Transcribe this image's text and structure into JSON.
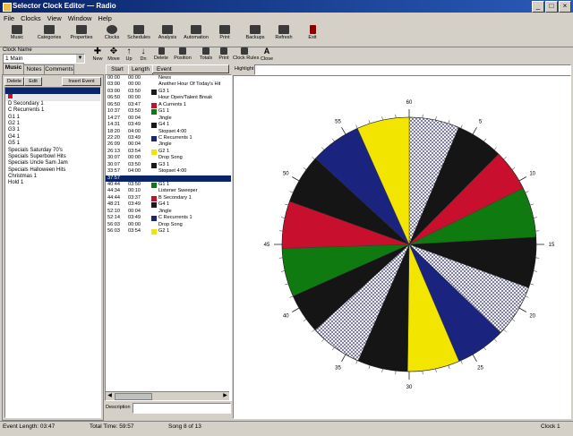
{
  "window": {
    "title": "Selector Clock Editor — Radio"
  },
  "menu": [
    "File",
    "Clocks",
    "View",
    "Window",
    "Help"
  ],
  "toolbar_top": [
    "Music",
    "Categories",
    "Properties",
    "Clocks",
    "Schedules",
    "Analysis",
    "Automation",
    "Print",
    "Backups",
    "Refresh",
    "Exit"
  ],
  "toolbar_nav": [
    "New",
    "Move",
    "Up",
    "Dn",
    "Delete",
    "Position",
    "Totals",
    "Print",
    "Clock Rules",
    "Close"
  ],
  "clock_name": {
    "label": "Clock Name",
    "value": "1 Main"
  },
  "left_tabs": [
    "Music",
    "Notes",
    "Comments"
  ],
  "left_buttons": [
    "Delete",
    "Edit",
    "Insert Event"
  ],
  "left_items": [
    "",
    "",
    "D Secondary 1",
    "C Recurrents 1",
    "G1 1",
    "G2 1",
    "G3 1",
    "G4 1",
    "G5 1",
    "Specials Saturday 70's",
    "Specials Superbowl Hits",
    "Specials Uncle Sam Jam",
    "Specials Halloween Hits",
    "Christmas 1",
    "Hold 1"
  ],
  "columns": [
    "Start",
    "Length",
    "Event"
  ],
  "events": [
    {
      "start": "00:00",
      "len": "00:00",
      "color": "",
      "name": "News"
    },
    {
      "start": "03:00",
      "len": "00:00",
      "color": "",
      "name": "Another Hour Of Today's Hit"
    },
    {
      "start": "03:00",
      "len": "03:50",
      "color": "#1a1a1a",
      "name": "G3 1"
    },
    {
      "start": "06:50",
      "len": "00:00",
      "color": "",
      "name": "Hour Open/Talent Break"
    },
    {
      "start": "06:50",
      "len": "03:47",
      "color": "#c8102e",
      "name": "A Currents 1"
    },
    {
      "start": "10:37",
      "len": "03:50",
      "color": "#0f7a0f",
      "name": "G1 1"
    },
    {
      "start": "14:27",
      "len": "00:04",
      "color": "",
      "name": "Jingle"
    },
    {
      "start": "14:31",
      "len": "03:49",
      "color": "#1a1a1a",
      "name": "G4 1"
    },
    {
      "start": "18:20",
      "len": "04:00",
      "color": "",
      "name": "Stopset 4:00"
    },
    {
      "start": "22:20",
      "len": "03:49",
      "color": "#1a237e",
      "name": "C Recurrents 1"
    },
    {
      "start": "26:09",
      "len": "00:04",
      "color": "",
      "name": "Jingle"
    },
    {
      "start": "26:13",
      "len": "03:54",
      "color": "#f2e600",
      "name": "G2 1"
    },
    {
      "start": "30:07",
      "len": "00:00",
      "color": "",
      "name": "Drop Song"
    },
    {
      "start": "30:07",
      "len": "03:50",
      "color": "#1a1a1a",
      "name": "G3 1"
    },
    {
      "start": "33:57",
      "len": "04:00",
      "color": "",
      "name": "Stopset 4:00"
    },
    {
      "start": "37:57",
      "len": "",
      "color": "",
      "name": "",
      "selected": true
    },
    {
      "start": "40:44",
      "len": "03:50",
      "color": "#0f7a0f",
      "name": "G1 1"
    },
    {
      "start": "44:34",
      "len": "00:10",
      "color": "",
      "name": "Listener Sweeper"
    },
    {
      "start": "44:44",
      "len": "03:37",
      "color": "#c8102e",
      "name": "B Secondary 1"
    },
    {
      "start": "48:21",
      "len": "03:49",
      "color": "#1a1a1a",
      "name": "G4 1"
    },
    {
      "start": "52:10",
      "len": "00:04",
      "color": "",
      "name": "Jingle"
    },
    {
      "start": "52:14",
      "len": "03:49",
      "color": "#1a237e",
      "name": "C Recurrents 1"
    },
    {
      "start": "56:03",
      "len": "00:00",
      "color": "",
      "name": "Drop Song"
    },
    {
      "start": "56:03",
      "len": "03:54",
      "color": "#f2e600",
      "name": "G2 1"
    }
  ],
  "description_label": "Description",
  "highlight_label": "Highlight",
  "clock_ticks": [
    "60",
    "5",
    "10",
    "15",
    "20",
    "25",
    "30",
    "35",
    "40",
    "45",
    "50",
    "55"
  ],
  "wheel_slices": [
    {
      "start": 0,
      "end": 3.83,
      "color": "#ffffff",
      "hatch": true
    },
    {
      "start": 3.83,
      "end": 7.45,
      "color": "#151515"
    },
    {
      "start": 7.45,
      "end": 10.62,
      "color": "#c8102e"
    },
    {
      "start": 10.62,
      "end": 14.45,
      "color": "#0f7a0f"
    },
    {
      "start": 14.45,
      "end": 18.33,
      "color": "#151515"
    },
    {
      "start": 18.33,
      "end": 22.33,
      "color": "#ffffff",
      "hatch": true
    },
    {
      "start": 22.33,
      "end": 26.15,
      "color": "#1a237e"
    },
    {
      "start": 26.15,
      "end": 30.12,
      "color": "#f2e600"
    },
    {
      "start": 30.12,
      "end": 33.95,
      "color": "#151515"
    },
    {
      "start": 33.95,
      "end": 37.95,
      "color": "#ffffff",
      "hatch": true
    },
    {
      "start": 37.95,
      "end": 41.0,
      "color": "#151515"
    },
    {
      "start": 41.0,
      "end": 44.7,
      "color": "#0f7a0f"
    },
    {
      "start": 44.7,
      "end": 48.3,
      "color": "#c8102e"
    },
    {
      "start": 48.3,
      "end": 52.1,
      "color": "#151515"
    },
    {
      "start": 52.1,
      "end": 56.0,
      "color": "#1a237e"
    },
    {
      "start": 56.0,
      "end": 60.0,
      "color": "#f2e600"
    }
  ],
  "status": {
    "event_length": "Event Length: 03:47",
    "total_time": "Total Time: 59:57",
    "song": "Song 8 of 13",
    "clock": "Clock 1"
  }
}
